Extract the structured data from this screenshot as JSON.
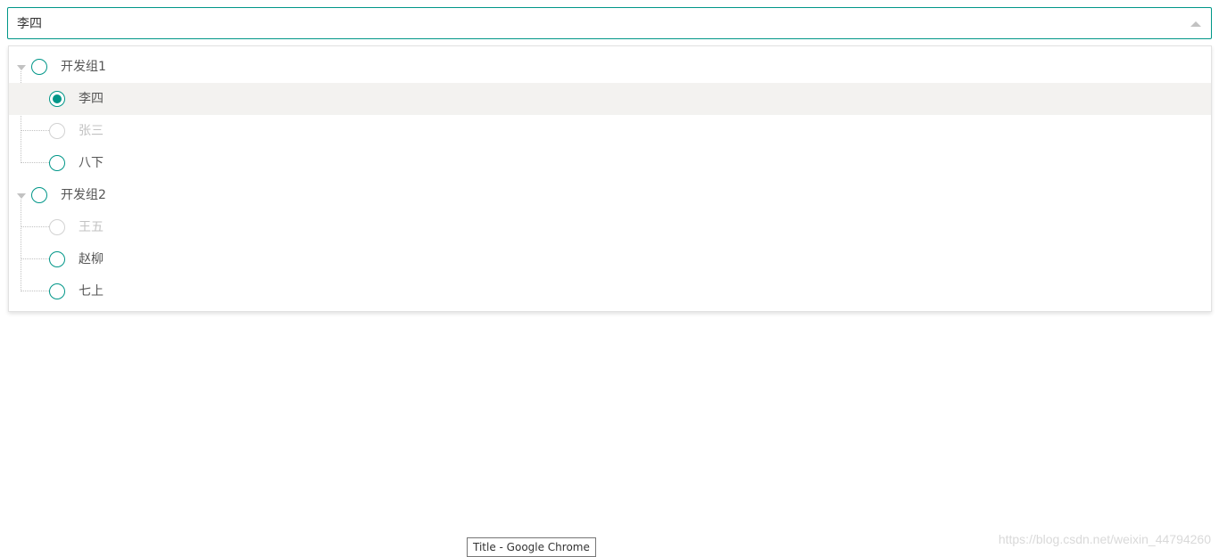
{
  "select": {
    "value": "李四"
  },
  "tree": {
    "groups": [
      {
        "label": "开发组1",
        "children": [
          {
            "label": "李四",
            "checked": true,
            "disabled": false
          },
          {
            "label": "张三",
            "checked": false,
            "disabled": true
          },
          {
            "label": "八下",
            "checked": false,
            "disabled": false
          }
        ]
      },
      {
        "label": "开发组2",
        "children": [
          {
            "label": "王五",
            "checked": false,
            "disabled": true
          },
          {
            "label": "赵柳",
            "checked": false,
            "disabled": false
          },
          {
            "label": "七上",
            "checked": false,
            "disabled": false
          }
        ]
      }
    ]
  },
  "tooltip": {
    "text": "Title - Google Chrome"
  },
  "watermark": {
    "text": "https://blog.csdn.net/weixin_44794260"
  },
  "colors": {
    "accent": "#009688",
    "disabled": "#c2c2c2",
    "selected_row": "#f3f2f0"
  }
}
